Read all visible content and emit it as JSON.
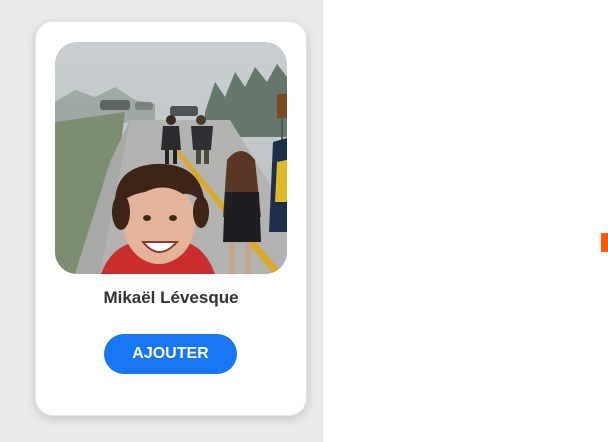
{
  "profile": {
    "name": "Mikaël Lévesque",
    "photo_icon": "profile-photo",
    "add_button_label": "AJOUTER"
  },
  "colors": {
    "left_panel_bg": "#eaeaea",
    "button_blue": "#1877f2",
    "accent_orange": "#ff5a00"
  }
}
